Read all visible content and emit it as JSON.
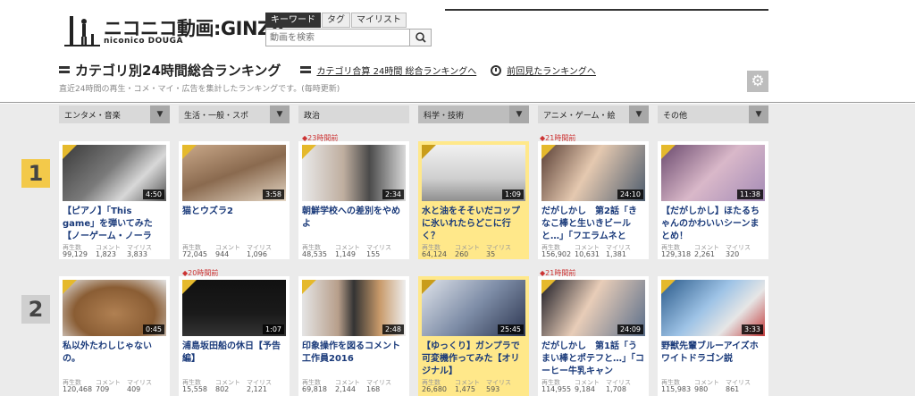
{
  "header": {
    "logo_main": "ニコニコ動画:GINZA",
    "logo_sub": "niconico DOUGA",
    "search_tabs": [
      "キーワード",
      "タグ",
      "マイリスト"
    ],
    "search_placeholder": "動画を検索"
  },
  "title_row": {
    "title": "カテゴリ別24時間総合ランキング",
    "link_total": "カテゴリ合算 24時間 総合ランキングへ",
    "link_previous": "前回見たランキングへ"
  },
  "subtitle": "直近24時間の再生・コメ・マイ・広告を集計したランキングです。(毎時更新)",
  "stat_labels": [
    "再生数",
    "コメント",
    "マイリス"
  ],
  "categories": [
    {
      "label": "エンタメ・音楽",
      "arrow": "▼"
    },
    {
      "label": "生活・一般・スポ",
      "arrow": "▼"
    },
    {
      "label": "政治",
      "arrow": "▼"
    },
    {
      "label": "科学・技術",
      "arrow": "▼"
    },
    {
      "label": "アニメ・ゲーム・絵",
      "arrow": "▼"
    },
    {
      "label": "その他",
      "arrow": "▼"
    }
  ],
  "ranks": [
    "1",
    "2"
  ],
  "colors": {
    "thumb_corner": "#e5b92c",
    "card_highlight": "#ffe88a",
    "timeago": "#cc3333",
    "title_link": "#1a3a7a"
  },
  "row1": [
    {
      "timeago": "",
      "duration": "4:50",
      "title": "【ピアノ】「This game」を弾いてみた【ノーゲーム・ノーラ",
      "views": "99,129",
      "comments": "1,823",
      "mylist": "3,833"
    },
    {
      "timeago": "",
      "duration": "3:58",
      "title": "猫とウズラ2",
      "views": "72,045",
      "comments": "944",
      "mylist": "1,096"
    },
    {
      "timeago": "◆23時間前",
      "duration": "2:34",
      "title": "朝鮮学校への差別をやめよ",
      "views": "48,535",
      "comments": "1,149",
      "mylist": "155"
    },
    {
      "timeago": "",
      "duration": "1:09",
      "title": "水と油をそそいだコップに氷いれたらどこに行く？",
      "views": "64,124",
      "comments": "260",
      "mylist": "35"
    },
    {
      "timeago": "◆21時間前",
      "duration": "24:10",
      "title": "だがしかし　第2話「きなこ棒と生いきビールと…」「フエラムネと",
      "views": "156,902",
      "comments": "10,631",
      "mylist": "1,381"
    },
    {
      "timeago": "",
      "duration": "11:38",
      "title": "【だがしかし】ほたるちゃんのかわいいシーンまとめ！",
      "views": "129,318",
      "comments": "2,261",
      "mylist": "320"
    }
  ],
  "row2": [
    {
      "timeago": "",
      "duration": "0:45",
      "title": "私以外たわしじゃないの。",
      "views": "120,468",
      "comments": "709",
      "mylist": "409"
    },
    {
      "timeago": "◆20時間前",
      "duration": "1:07",
      "title": "浦島坂田船の休日【予告編】",
      "views": "15,558",
      "comments": "802",
      "mylist": "2,121"
    },
    {
      "timeago": "",
      "duration": "2:48",
      "title": "印象操作を図るコメント工作員2016",
      "views": "69,818",
      "comments": "2,144",
      "mylist": "168"
    },
    {
      "timeago": "",
      "duration": "25:45",
      "title": "【ゆっくり】ガンプラで可変機作ってみた【オリジナル】",
      "views": "26,680",
      "comments": "1,475",
      "mylist": "593"
    },
    {
      "timeago": "◆21時間前",
      "duration": "24:09",
      "title": "だがしかし　第1話「うまい棒とポテフと…」「コーヒー牛乳キャン",
      "views": "114,955",
      "comments": "9,184",
      "mylist": "1,708"
    },
    {
      "timeago": "",
      "duration": "3:33",
      "title": "野獣先輩ブルーアイズホワイトドラゴン説",
      "views": "115,983",
      "comments": "980",
      "mylist": "861"
    }
  ]
}
